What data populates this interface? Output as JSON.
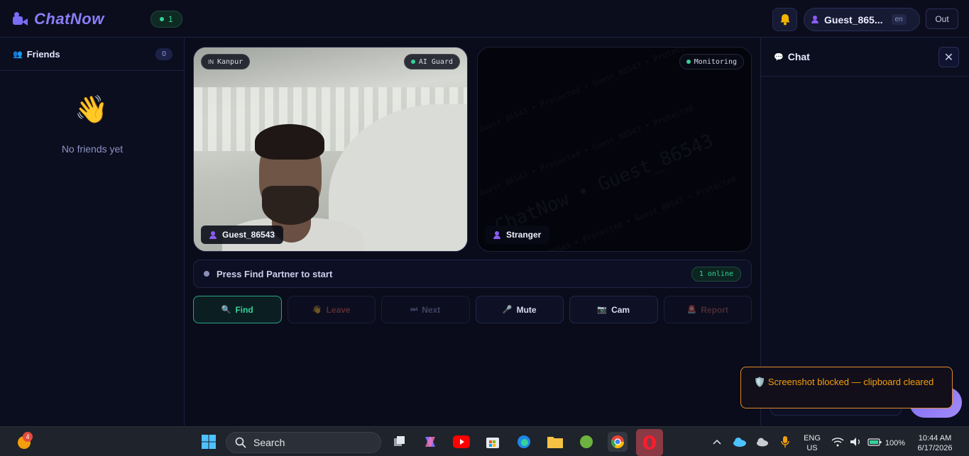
{
  "header": {
    "app_name": "ChatNow",
    "online_count": "1",
    "user_name": "Guest_865...",
    "language": "en",
    "logout_label": "Out"
  },
  "sidebar": {
    "title": "Friends",
    "count": "0",
    "empty_text": "No friends yet"
  },
  "local_video": {
    "location_prefix": "IN",
    "location": "Kanpur",
    "guard_label": "AI Guard",
    "name": "Guest_86543"
  },
  "remote_video": {
    "monitoring_label": "Monitoring",
    "name": "Stranger",
    "watermark_main": "ChatNow • Guest_86543",
    "watermark_small": "Guest_86543 • Protected • Guest_86543 • Protected"
  },
  "status": {
    "text": "Press Find Partner to start",
    "online": "1 online"
  },
  "controls": {
    "find": "Find",
    "leave": "Leave",
    "next": "Next",
    "mute": "Mute",
    "cam": "Cam",
    "report": "Report"
  },
  "chat": {
    "title": "Chat",
    "input_placeholder": "Type a message...",
    "send_label": "Send"
  },
  "toast": {
    "text": "Screenshot blocked — clipboard cleared"
  },
  "taskbar": {
    "notification_count": "4",
    "search_label": "Search",
    "language_line1": "ENG",
    "language_line2": "US",
    "battery": "100%",
    "time": "10:44 AM",
    "date": "6/17/2026"
  },
  "colors": {
    "accent": "#7c6df6",
    "online_green": "#34d399",
    "toast_orange": "#f59e0b"
  }
}
